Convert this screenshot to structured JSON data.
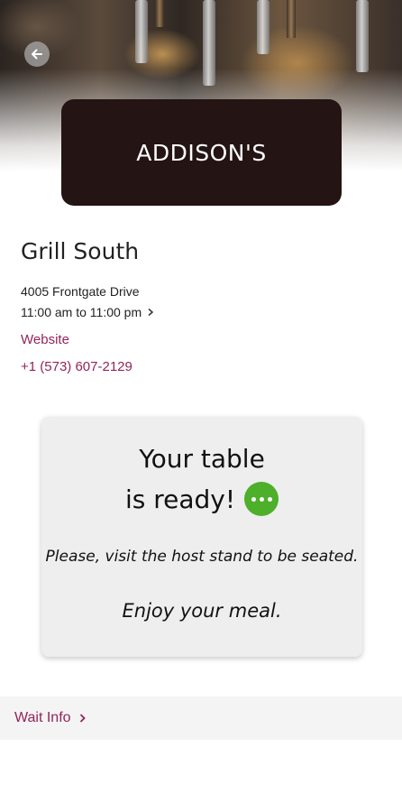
{
  "header": {
    "back_icon": "arrow-left-icon",
    "hero_image": "bar-taps-photo"
  },
  "brand": {
    "name": "ADDISON'S",
    "card_color": "#241414"
  },
  "location": {
    "name": "Grill South",
    "address": "4005 Frontgate Drive",
    "hours": "11:00 am to 11:00 pm",
    "website_label": "Website",
    "phone": "+1 (573) 607-2129",
    "link_color": "#93245a"
  },
  "status": {
    "line1": "Your table",
    "line2": "is ready!",
    "icon": "ellipsis-circle-icon",
    "icon_color": "#4daf2a",
    "instruction": "Please, visit the host stand to be seated.",
    "closing": "Enjoy your meal."
  },
  "footer": {
    "wait_info_label": "Wait Info"
  }
}
